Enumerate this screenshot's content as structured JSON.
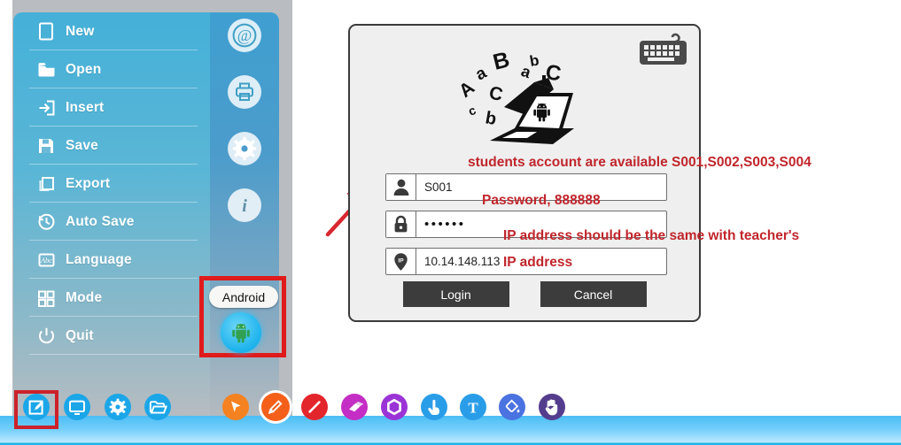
{
  "app": {
    "accent_blue": "#45b0d8",
    "annotation_red": "#c0262c",
    "highlight_red": "#cc2229"
  },
  "sidebar": {
    "items": [
      {
        "label": "New",
        "icon": "file-icon"
      },
      {
        "label": "Open",
        "icon": "folder-icon"
      },
      {
        "label": "Insert",
        "icon": "insert-arrow-icon"
      },
      {
        "label": "Save",
        "icon": "floppy-disk-icon"
      },
      {
        "label": "Export",
        "icon": "copy-export-icon"
      },
      {
        "label": "Auto Save",
        "icon": "clock-rotate-icon"
      },
      {
        "label": "Language",
        "icon": "abc-board-icon"
      },
      {
        "label": "Mode",
        "icon": "grid-squares-icon"
      },
      {
        "label": "Quit",
        "icon": "power-icon"
      }
    ],
    "rail": [
      {
        "icon": "at-email-icon",
        "name": "email"
      },
      {
        "icon": "printer-icon",
        "name": "print"
      },
      {
        "icon": "gear-icon",
        "name": "settings"
      },
      {
        "icon": "info-icon",
        "name": "info"
      }
    ],
    "android": {
      "tooltip": "Android",
      "icon": "android-robot-icon"
    }
  },
  "dialog": {
    "hero_icon": "laptop-graduation-android-icon",
    "keyboard_icon": "keyboard-icon",
    "fields": [
      {
        "name": "account",
        "icon": "person-icon",
        "value": "S001",
        "masked": false
      },
      {
        "name": "password",
        "icon": "lock-icon",
        "value": "••••••",
        "masked": true
      },
      {
        "name": "ip",
        "icon": "ip-pin-icon",
        "value": "10.14.148.113",
        "masked": false
      }
    ],
    "buttons": {
      "login": "Login",
      "cancel": "Cancel"
    }
  },
  "annotations": {
    "account": "students account are available S001,S002,S003,S004",
    "password": "Password, 888888",
    "ip_line1": "IP address should be the same with teacher's",
    "ip_line2": "IP address"
  },
  "taskbar": {
    "left_tools": [
      {
        "name": "edit-board-icon",
        "color": "#1ba6e8",
        "selected": true
      },
      {
        "name": "monitor-icon",
        "color": "#1ba6e8",
        "selected": false
      },
      {
        "name": "gear-icon",
        "color": "#1ba6e8",
        "selected": false
      },
      {
        "name": "open-folder-icon",
        "color": "#1ba6e8",
        "selected": false
      }
    ],
    "right_tools": [
      {
        "name": "cursor-arrow-icon",
        "color": "#f58220",
        "selected": false
      },
      {
        "name": "pencil-icon",
        "color": "#f4601a",
        "selected": true
      },
      {
        "name": "line-icon",
        "color": "#e3262c",
        "selected": false
      },
      {
        "name": "eraser-icon",
        "color": "#c42ec4",
        "selected": false
      },
      {
        "name": "shape-icon",
        "color": "#9b34d6",
        "selected": false
      },
      {
        "name": "pointing-hand-icon",
        "color": "#2a9de8",
        "selected": false
      },
      {
        "name": "text-tool-icon",
        "color": "#2a9de8",
        "selected": false
      },
      {
        "name": "paint-bucket-icon",
        "color": "#4a72e0",
        "selected": false
      },
      {
        "name": "palm-hand-icon",
        "color": "#553d8e",
        "selected": false
      }
    ]
  }
}
